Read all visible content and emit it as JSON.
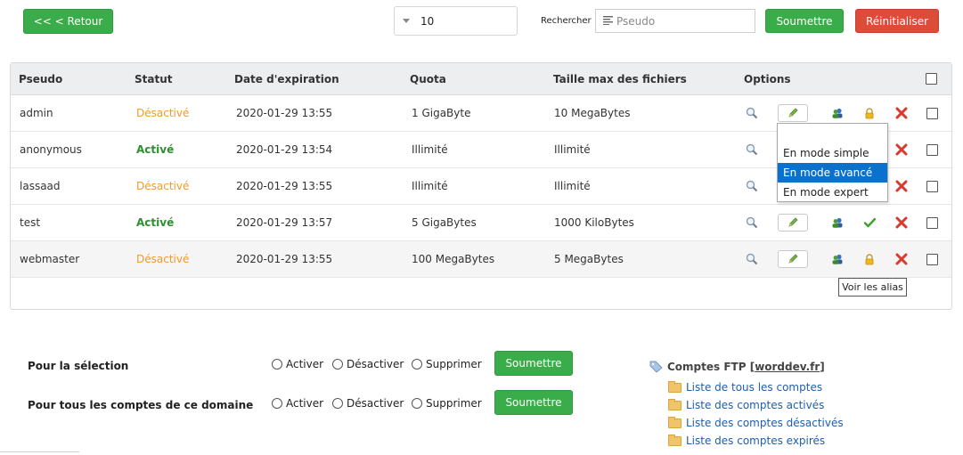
{
  "toolbar": {
    "back_label": "<< < Retour",
    "per_page_value": "10",
    "search_label": "Rechercher",
    "search_placeholder": "Pseudo",
    "submit_label": "Soumettre",
    "reset_label": "Réinitialiser"
  },
  "table": {
    "headers": {
      "pseudo": "Pseudo",
      "statut": "Statut",
      "expiration": "Date d'expiration",
      "quota": "Quota",
      "max_file": "Taille max des fichiers",
      "options": "Options"
    },
    "rows": [
      {
        "pseudo": "admin",
        "statut": "Désactivé",
        "expiration": "2020-01-29 13:55",
        "quota": "1 GigaByte",
        "max_file": "10 MegaBytes"
      },
      {
        "pseudo": "anonymous",
        "statut": "Activé",
        "expiration": "2020-01-29 13:54",
        "quota": "Illimité",
        "max_file": "Illimité"
      },
      {
        "pseudo": "lassaad",
        "statut": "Désactivé",
        "expiration": "2020-01-29 13:55",
        "quota": "Illimité",
        "max_file": "Illimité"
      },
      {
        "pseudo": "test",
        "statut": "Activé",
        "expiration": "2020-01-29 13:57",
        "quota": "5 GigaBytes",
        "max_file": "1000 KiloBytes"
      },
      {
        "pseudo": "webmaster",
        "statut": "Désactivé",
        "expiration": "2020-01-29 13:55",
        "quota": "100 MegaBytes",
        "max_file": "5 MegaBytes"
      }
    ]
  },
  "edit_menu": {
    "items": [
      "En mode simple",
      "En mode avancé",
      "En mode expert"
    ],
    "active_index": 1
  },
  "tooltip": "Voir les alias",
  "bulk": {
    "selection_label": "Pour la sélection",
    "domain_label": "Pour tous les comptes de ce domaine",
    "opt_activate": "Activer",
    "opt_deactivate": "Désactiver",
    "opt_delete": "Supprimer",
    "submit_label": "Soumettre"
  },
  "sidebar": {
    "title_prefix": "Comptes FTP [ ",
    "domain": "worddev.fr",
    "title_suffix": " ]",
    "links": [
      "Liste de tous les comptes",
      "Liste des comptes activés",
      "Liste des comptes désactivés",
      "Liste des comptes expirés"
    ]
  },
  "colors": {
    "green": "#3aac4a",
    "red": "#dd4b39",
    "status_off": "#ef9a2e",
    "status_on": "#2f8f2f",
    "menu_active": "#0a72cc",
    "link": "#1f5fa8"
  }
}
